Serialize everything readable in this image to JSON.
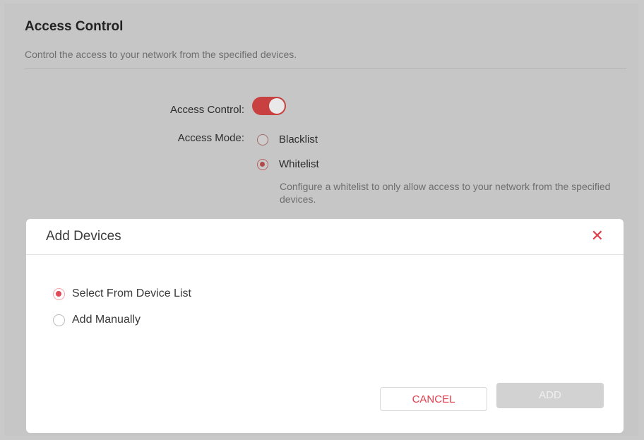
{
  "page": {
    "title": "Access Control",
    "description": "Control the access to your network from the specified devices."
  },
  "access_control": {
    "label": "Access Control:",
    "enabled": true,
    "mode_label": "Access Mode:",
    "modes": [
      {
        "label": "Blacklist",
        "selected": false
      },
      {
        "label": "Whitelist",
        "selected": true
      }
    ],
    "hint": "Configure a whitelist to only allow access to your network from the specified devices."
  },
  "modal": {
    "title": "Add Devices",
    "close_icon": "close-icon",
    "options": [
      {
        "label": "Select From Device List",
        "selected": true
      },
      {
        "label": "Add Manually",
        "selected": false
      }
    ],
    "cancel_label": "CANCEL",
    "add_label": "ADD"
  },
  "colors": {
    "accent": "#e23b4a",
    "toggle_on": "#c84040",
    "disabled_button": "#d2d2d2"
  }
}
